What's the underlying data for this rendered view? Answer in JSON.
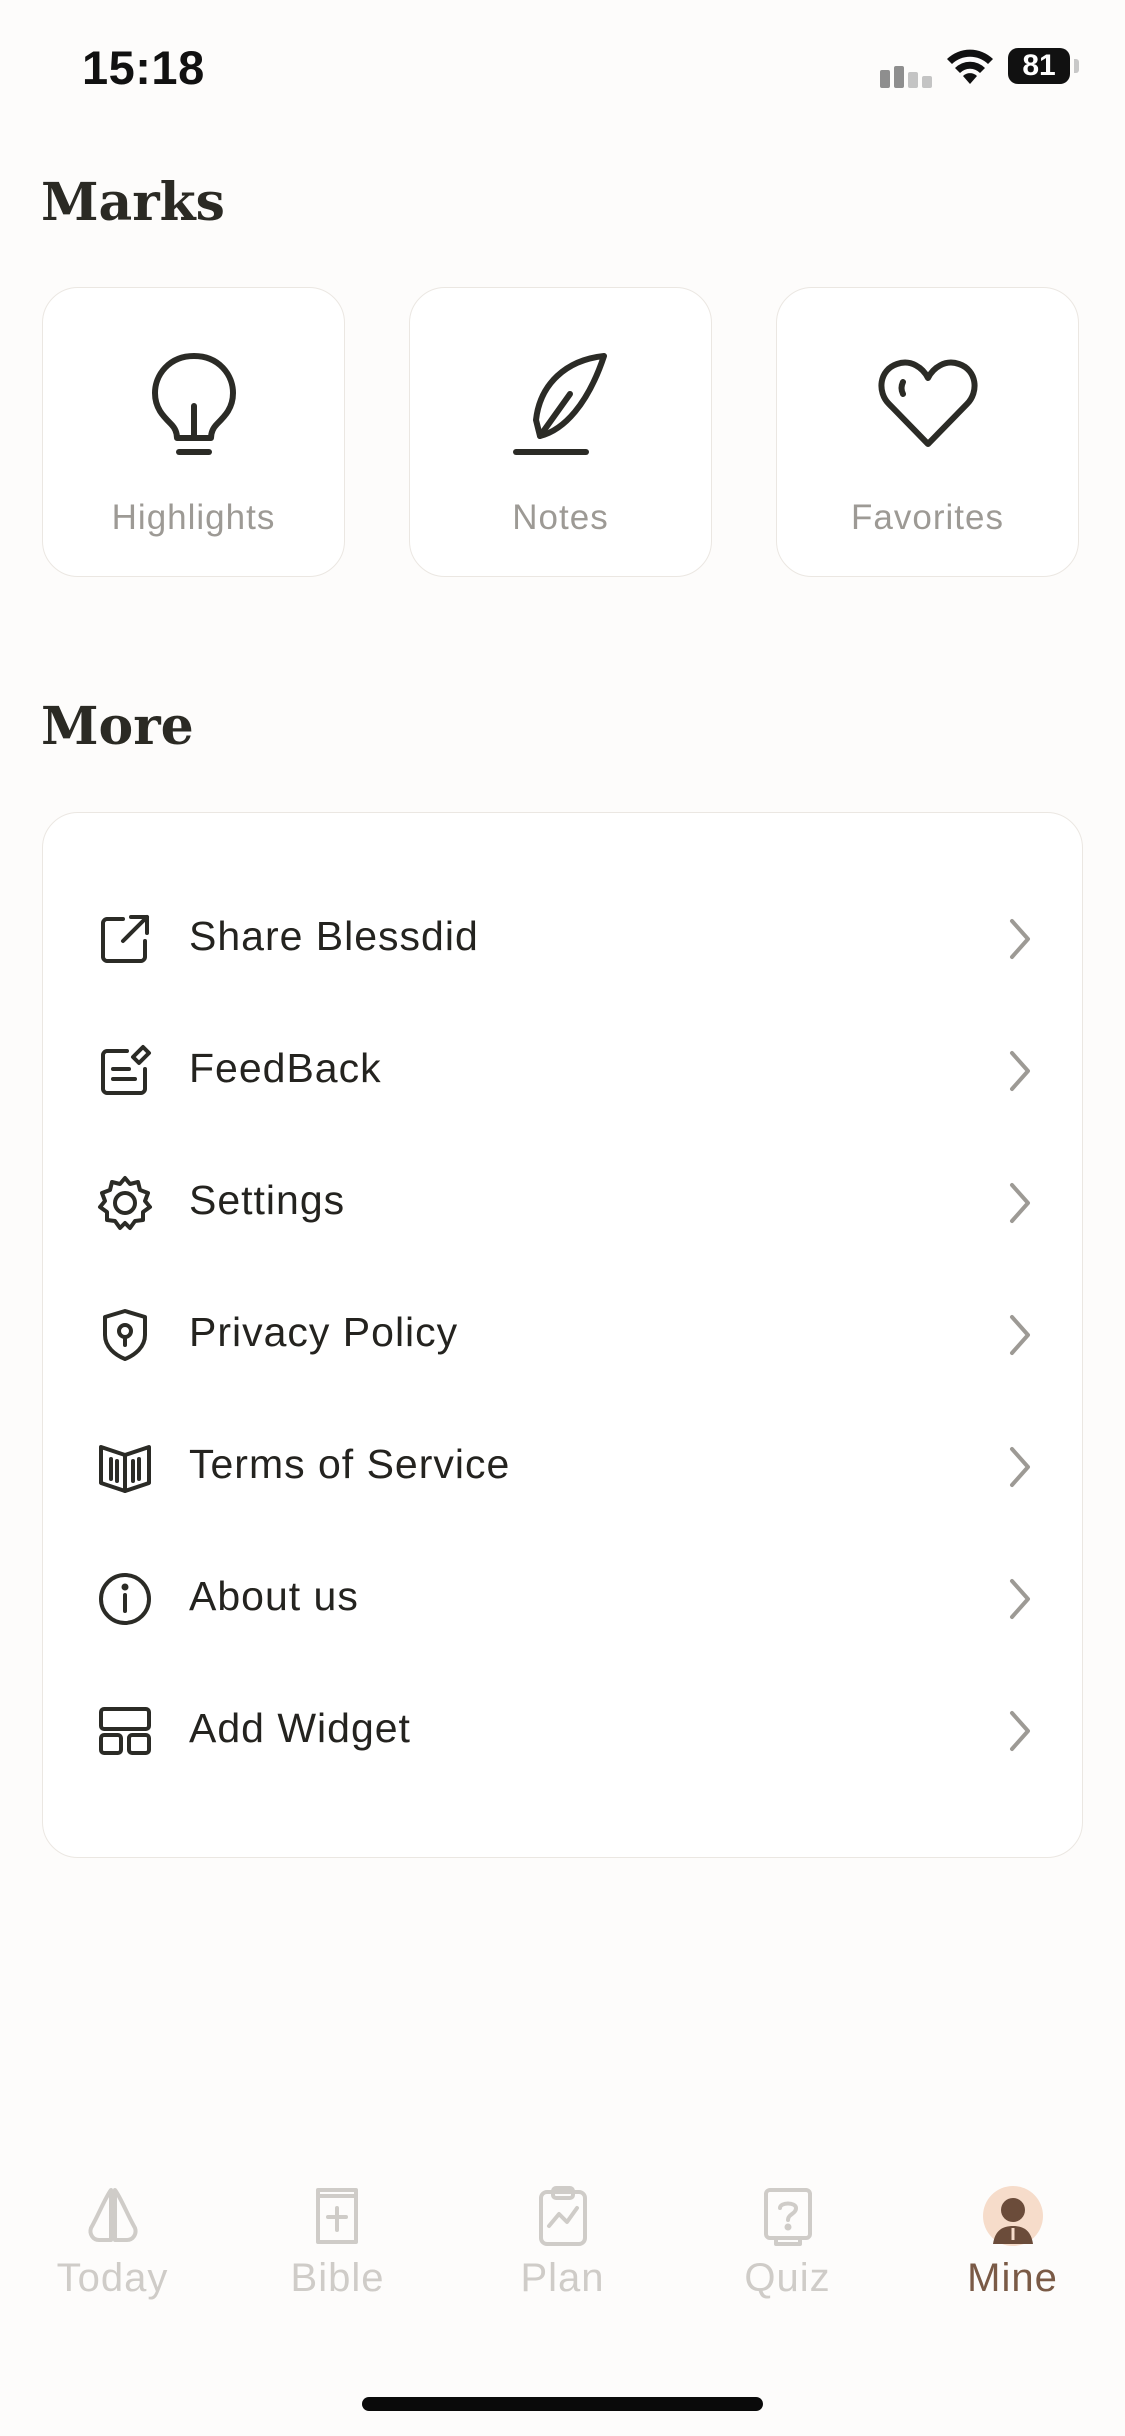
{
  "status_bar": {
    "time": "15:18",
    "battery": "81"
  },
  "marks": {
    "title": "Marks",
    "items": [
      {
        "label": "Highlights",
        "icon": "lightbulb-icon"
      },
      {
        "label": "Notes",
        "icon": "quill-icon"
      },
      {
        "label": "Favorites",
        "icon": "heart-icon"
      }
    ]
  },
  "more": {
    "title": "More",
    "items": [
      {
        "label": "Share Blessdid",
        "icon": "share-icon"
      },
      {
        "label": "FeedBack",
        "icon": "feedback-icon"
      },
      {
        "label": "Settings",
        "icon": "gear-icon"
      },
      {
        "label": "Privacy Policy",
        "icon": "shield-icon"
      },
      {
        "label": "Terms of Service",
        "icon": "book-icon"
      },
      {
        "label": "About us",
        "icon": "info-icon"
      },
      {
        "label": "Add Widget",
        "icon": "widget-icon"
      }
    ]
  },
  "tabs": [
    {
      "label": "Today",
      "icon": "praying-hands-icon"
    },
    {
      "label": "Bible",
      "icon": "bible-icon"
    },
    {
      "label": "Plan",
      "icon": "clipboard-chart-icon"
    },
    {
      "label": "Quiz",
      "icon": "question-book-icon"
    },
    {
      "label": "Mine",
      "icon": "avatar-icon",
      "active": true
    }
  ],
  "colors": {
    "accent": "#7a5a46",
    "inactive_tab": "#cfccc8",
    "card_border": "#ebe7e2"
  }
}
